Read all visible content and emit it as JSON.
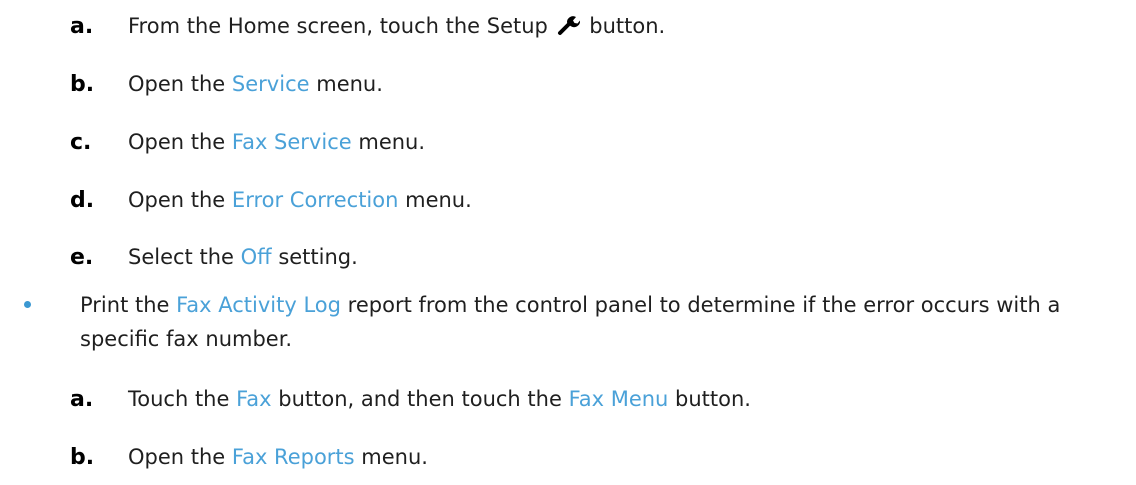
{
  "steps_top": [
    {
      "letter": "a.",
      "pre": "From the Home screen, touch the Setup",
      "post": "button."
    },
    {
      "letter": "b.",
      "pre": "Open the",
      "ui": "Service",
      "post": "menu."
    },
    {
      "letter": "c.",
      "pre": "Open the",
      "ui": "Fax Service",
      "post": "menu."
    },
    {
      "letter": "d.",
      "pre": "Open the",
      "ui": "Error Correction",
      "post": "menu."
    },
    {
      "letter": "e.",
      "pre": "Select the",
      "ui": "Off",
      "post": "setting."
    }
  ],
  "bullet": {
    "pre": "Print the",
    "ui": "Fax Activity Log",
    "post": "report from the control panel to determine if the error occurs with a specific fax number."
  },
  "steps_bottom": [
    {
      "letter": "a.",
      "pre": "Touch the",
      "ui1": "Fax",
      "mid": "button, and then touch the",
      "ui2": "Fax Menu",
      "post": "button."
    },
    {
      "letter": "b.",
      "pre": "Open the",
      "ui": "Fax Reports",
      "post": "menu."
    }
  ],
  "icons": {
    "setup": "wrench-icon"
  },
  "colors": {
    "ui_label": "#4aa1d8",
    "bullet": "#3b98d2"
  }
}
